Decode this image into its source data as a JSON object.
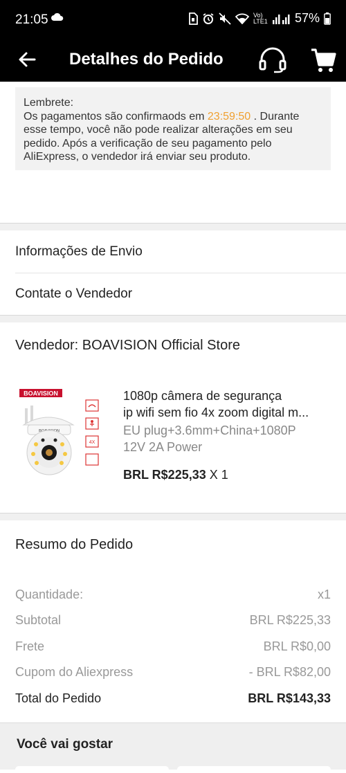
{
  "status_bar": {
    "time": "21:05",
    "battery": "57%",
    "network": "Vo) LTE1",
    "icons": [
      "cloud-icon",
      "sim-icon",
      "alarm-icon",
      "mute-icon",
      "wifi-icon",
      "signal-icon",
      "battery-icon"
    ]
  },
  "header": {
    "title": "Detalhes do Pedido",
    "icons": [
      "back-arrow-icon",
      "headset-icon",
      "cart-icon"
    ]
  },
  "reminder": {
    "label": "Lembrete:",
    "text_before_timer": "Os pagamentos são confirmaods em ",
    "timer": "23:59:50",
    "text_after_timer": " . Durante esse tempo, você não pode realizar alterações em seu pedido. Após a verificação de seu pagamento pelo AliExpress, o vendedor irá enviar seu produto.",
    "timer_color": "#f0a030"
  },
  "menu": {
    "shipping_info": "Informações de Envio",
    "contact_seller": "Contate o Vendedor"
  },
  "seller": {
    "label": "Vendedor: BOAVISION Official Store"
  },
  "product": {
    "brand_badge": "BOAVISION",
    "title_line1": "1080p câmera de segurança",
    "title_line2": "ip wifi sem fio 4x zoom digital m...",
    "variant_line1": "EU plug+3.6mm+China+1080P",
    "variant_line2": "12V 2A Power",
    "price": "BRL R$225,33",
    "quantity": "X 1"
  },
  "summary": {
    "title": "Resumo do Pedido",
    "rows": [
      {
        "label": "Quantidade:",
        "value": "x1"
      },
      {
        "label": "Subtotal",
        "value": "BRL R$225,33"
      },
      {
        "label": "Frete",
        "value": "BRL R$0,00"
      },
      {
        "label": "Cupom do Aliexpress",
        "value": "- BRL R$82,00"
      }
    ],
    "total_label": "Total do Pedido",
    "total_value": "BRL R$143,33"
  },
  "recommendations": {
    "title": "Você vai gostar"
  },
  "colors": {
    "header_bg": "#000000",
    "accent_timer": "#f0a030",
    "band_bg": "#f0f0f0"
  }
}
